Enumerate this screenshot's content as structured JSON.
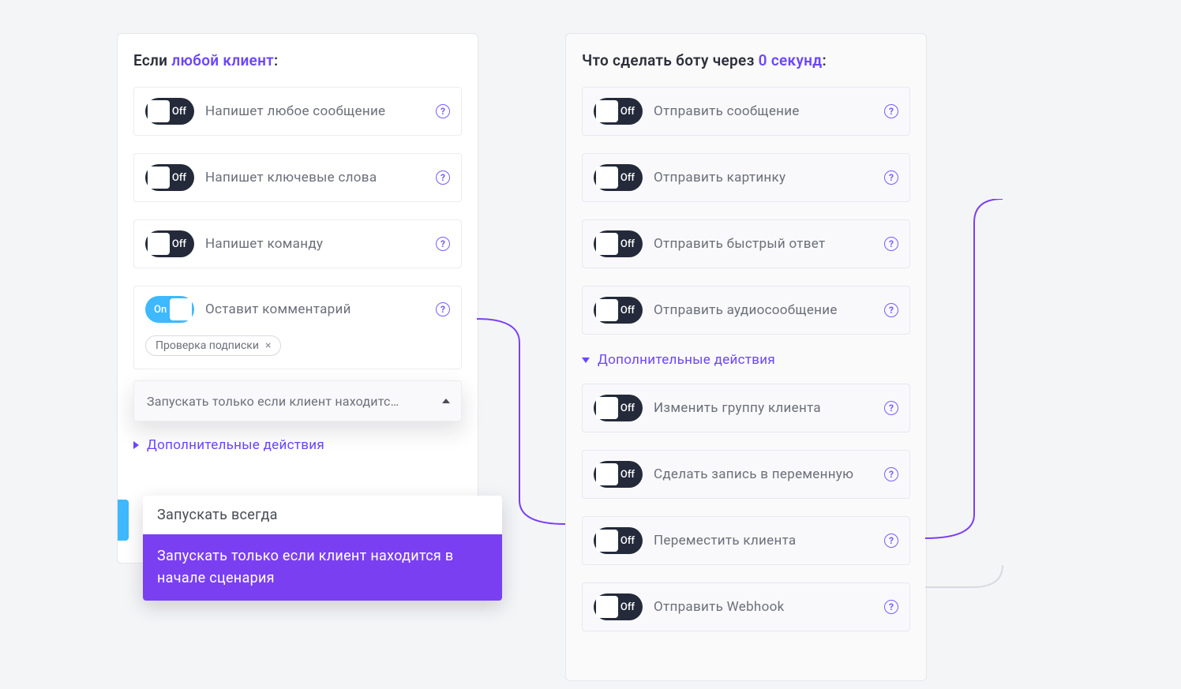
{
  "left": {
    "title_prefix": "Если ",
    "title_accent": "любой клиент",
    "title_suffix": ":",
    "items": [
      {
        "state": "Off",
        "label": "Напишет любое сообщение"
      },
      {
        "state": "Off",
        "label": "Напишет ключевые слова"
      },
      {
        "state": "Off",
        "label": "Напишет команду"
      }
    ],
    "comment": {
      "state": "On",
      "label": "Оставит комментарий",
      "tag": "Проверка подписки"
    },
    "dropdown_text": "Запускать только если клиент находитс…",
    "extra_label": "Дополнительные действия",
    "menu": {
      "opt1": "Запускать всегда",
      "opt2": "Запускать только если клиент находится в начале сценария"
    }
  },
  "right": {
    "title_prefix": "Что сделать боту через ",
    "title_accent": "0 секунд",
    "title_suffix": ":",
    "items_top": [
      {
        "state": "Off",
        "label": "Отправить сообщение"
      },
      {
        "state": "Off",
        "label": "Отправить картинку"
      },
      {
        "state": "Off",
        "label": "Отправить быстрый ответ"
      },
      {
        "state": "Off",
        "label": "Отправить аудиосообщение"
      }
    ],
    "extra_label": "Дополнительные действия",
    "items_bottom": [
      {
        "state": "Off",
        "label": "Изменить группу клиента"
      },
      {
        "state": "Off",
        "label": "Сделать запись в переменную"
      },
      {
        "state": "Off",
        "label": "Переместить клиента"
      },
      {
        "state": "Off",
        "label": "Отправить Webhook"
      }
    ]
  }
}
